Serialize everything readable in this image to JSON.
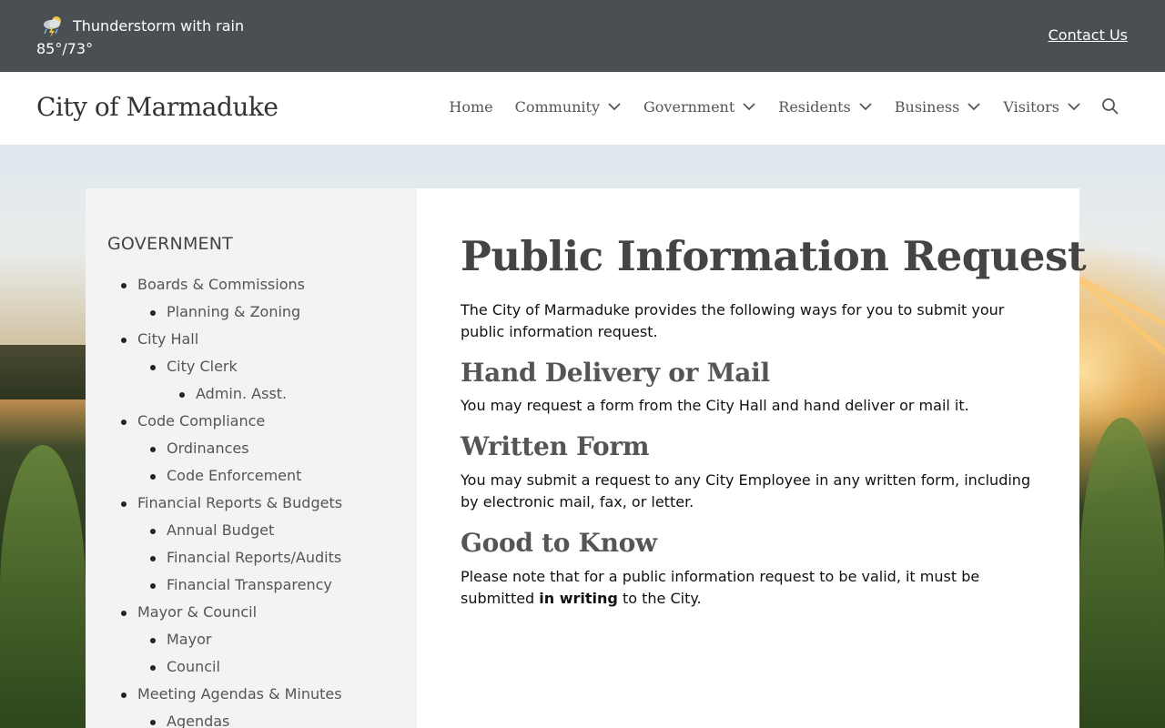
{
  "topbar": {
    "weather_icon": "thunderstorm-rain-icon",
    "condition": "Thunderstorm with rain",
    "temps": "85°/73°",
    "contact_label": "Contact Us"
  },
  "header": {
    "site_title": "City of Marmaduke",
    "nav": [
      {
        "label": "Home"
      },
      {
        "label": "Community"
      },
      {
        "label": "Government"
      },
      {
        "label": "Residents"
      },
      {
        "label": "Business"
      },
      {
        "label": "Visitors"
      }
    ],
    "search_icon": "search-icon"
  },
  "sidebar": {
    "title": "GOVERNMENT",
    "items": [
      {
        "label": "Boards & Commissions",
        "level": 1
      },
      {
        "label": "Planning & Zoning",
        "level": 2
      },
      {
        "label": "City Hall",
        "level": 1
      },
      {
        "label": "City Clerk",
        "level": 2
      },
      {
        "label": "Admin. Asst.",
        "level": 3
      },
      {
        "label": "Code Compliance",
        "level": 1
      },
      {
        "label": "Ordinances",
        "level": 2
      },
      {
        "label": "Code Enforcement",
        "level": 2
      },
      {
        "label": "Financial Reports & Budgets",
        "level": 1
      },
      {
        "label": "Annual Budget",
        "level": 2
      },
      {
        "label": "Financial Reports/Audits",
        "level": 2
      },
      {
        "label": "Financial Transparency",
        "level": 2
      },
      {
        "label": "Mayor & Council",
        "level": 1
      },
      {
        "label": "Mayor",
        "level": 2
      },
      {
        "label": "Council",
        "level": 2
      },
      {
        "label": "Meeting Agendas & Minutes",
        "level": 1
      },
      {
        "label": "Agendas",
        "level": 2
      }
    ]
  },
  "main": {
    "title": "Public Information Request",
    "intro": "The City of Marmaduke provides the following ways for you to submit your public information request.",
    "sections": [
      {
        "heading": "Hand Delivery or Mail",
        "text": "You may request a form from the City Hall and hand deliver or mail it."
      },
      {
        "heading": "Written Form",
        "text": "You may submit a request to any City Employee in any written form, including by electronic mail, fax, or letter."
      },
      {
        "heading": "Good to Know",
        "text_before": "Please note that for a public information request to be valid, it must be submitted ",
        "text_bold": "in writing",
        "text_after": " to the City."
      }
    ]
  },
  "colors": {
    "topbar_bg": "#4a4f54",
    "sidebar_bg": "#f3f3f3",
    "heading": "#444444"
  }
}
